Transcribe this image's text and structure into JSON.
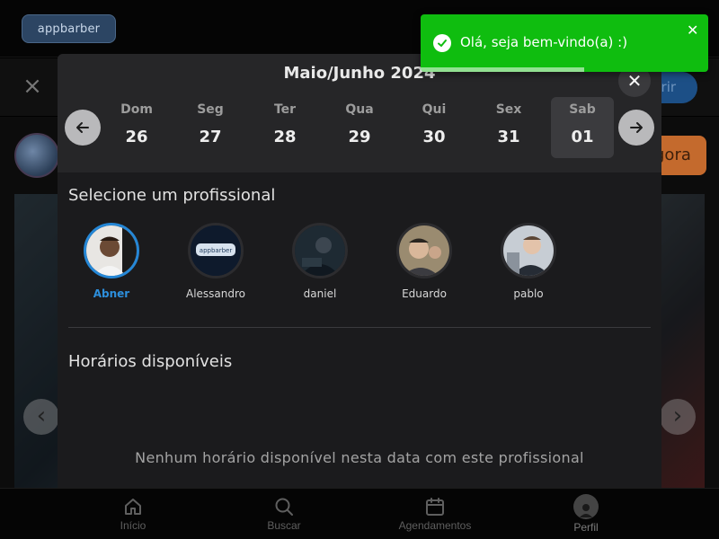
{
  "app": {
    "logo_text": "appbarber"
  },
  "background": {
    "open_button_label": "brir",
    "book_button_label": "gora"
  },
  "modal": {
    "month_title": "Maio/Junho 2024",
    "days": [
      {
        "name": "Dom",
        "number": "26",
        "selected": false
      },
      {
        "name": "Seg",
        "number": "27",
        "selected": false
      },
      {
        "name": "Ter",
        "number": "28",
        "selected": false
      },
      {
        "name": "Qua",
        "number": "29",
        "selected": false
      },
      {
        "name": "Qui",
        "number": "30",
        "selected": false
      },
      {
        "name": "Sex",
        "number": "31",
        "selected": false
      },
      {
        "name": "Sab",
        "number": "01",
        "selected": true
      }
    ],
    "professionals_title": "Selecione um profissional",
    "professionals": [
      {
        "name": "Abner",
        "selected": true
      },
      {
        "name": "Alessandro",
        "selected": false,
        "avatar_text": "appbarber"
      },
      {
        "name": "daniel",
        "selected": false
      },
      {
        "name": "Eduardo",
        "selected": false
      },
      {
        "name": "pablo",
        "selected": false
      }
    ],
    "times_title": "Horários disponíveis",
    "empty_message": "Nenhum horário disponível nesta data com este profissional"
  },
  "toast": {
    "message": "Olá, seja bem-vindo(a) :)",
    "progress": 0.57,
    "color": "#0fbd0f"
  },
  "bottom_nav": {
    "items": [
      {
        "label": "Início",
        "icon": "home-icon"
      },
      {
        "label": "Buscar",
        "icon": "search-icon"
      },
      {
        "label": "Agendamentos",
        "icon": "calendar-icon"
      },
      {
        "label": "Perfil",
        "icon": "profile-icon"
      }
    ]
  },
  "colors": {
    "accent": "#2587d6",
    "modal_bg": "#1b1b1d",
    "date_strip_bg": "#262628"
  }
}
